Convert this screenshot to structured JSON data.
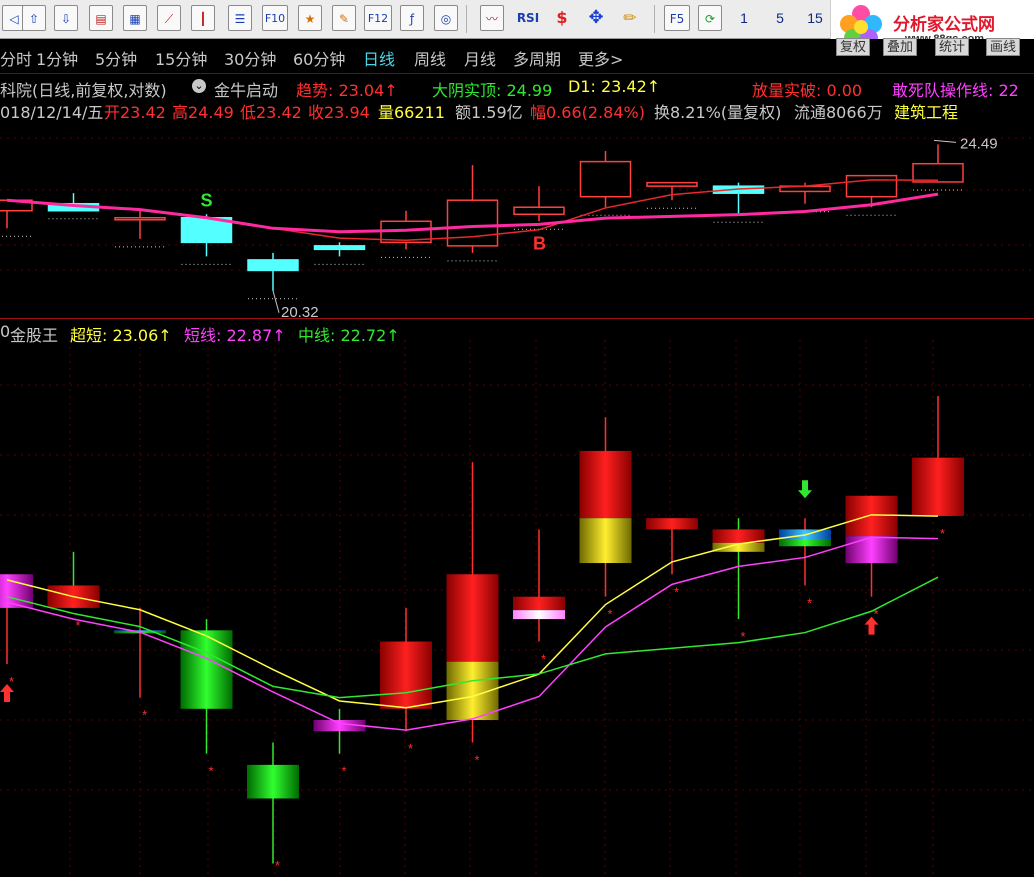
{
  "toolbar": {
    "icons": [
      "back-arrow-icon",
      "up-arrow-icon",
      "down-arrow-icon",
      "report-icon",
      "spreadsheet-icon",
      "line-chart-icon",
      "candle-chart-icon",
      "list-icon",
      "f10-icon",
      "favorite-icon",
      "note-icon",
      "f12-icon",
      "formula-icon",
      "target-icon",
      "wave-chart-icon",
      "rsi-icon",
      "money-icon",
      "move-icon",
      "pencil-icon",
      "f5-icon",
      "refresh-icon"
    ],
    "f10_label": "F10",
    "f12_label": "F12",
    "rsi_label": "RSI",
    "f5_label": "F5",
    "num1": "1",
    "num5": "5",
    "num15": "15"
  },
  "logo": {
    "title": "分析家公式网",
    "url": "www.88gs.com"
  },
  "periods": [
    "分时",
    "1分钟",
    "5分钟",
    "15分钟",
    "30分钟",
    "60分钟",
    "日线",
    "周线",
    "月线",
    "多周期",
    "更多>"
  ],
  "active_period": "日线",
  "right_buttons": [
    "复权",
    "叠加",
    "统计",
    "画线"
  ],
  "price_panel": {
    "name": "科院(日线,前复权,对数)",
    "indicator": "金牛启动",
    "trend_label": "趋势: 23.04↑",
    "dayin_label": "大阴实顶: 24.99",
    "d1_label": "D1: 23.42↑",
    "vol_break_label": "放量实破: 0.00",
    "dare_label": "敢死队操作线: 22",
    "date": "018/12/14/五",
    "open": "开23.42",
    "high": "高24.49",
    "low": "低23.42",
    "close": "收23.94",
    "volume": "量66211",
    "amount": "额1.59亿",
    "change": "幅0.66(2.84%)",
    "turnover": "换8.21%(量复权)",
    "float": "流通8066万",
    "sector": "建筑工程",
    "high_mark": "24.49",
    "low_mark": "20.32",
    "sell_signal": "S",
    "buy_signal": "B"
  },
  "indicator_panel": {
    "prefix": "0",
    "name": "金股王",
    "super_short": "超短: 23.06↑",
    "short": "短线: 22.87↑",
    "mid": "中线: 22.72↑"
  },
  "colors": {
    "up": "#ff4040",
    "down": "#54ffff",
    "ma_red": "#e8282c",
    "ma_pink": "#ff2aa0",
    "ind_yellow": "#ffff40",
    "ind_magenta": "#ff40ff",
    "ind_green": "#30e830"
  },
  "candles": [
    {
      "o": 22.6,
      "h": 22.9,
      "l": 22.1,
      "c": 22.9
    },
    {
      "o": 22.8,
      "h": 23.1,
      "l": 22.6,
      "c": 22.6
    },
    {
      "o": 22.4,
      "h": 22.6,
      "l": 21.8,
      "c": 22.4
    },
    {
      "o": 22.4,
      "h": 22.5,
      "l": 21.3,
      "c": 21.7
    },
    {
      "o": 21.2,
      "h": 21.4,
      "l": 20.32,
      "c": 20.9
    },
    {
      "o": 21.6,
      "h": 21.7,
      "l": 21.3,
      "c": 21.5
    },
    {
      "o": 21.7,
      "h": 22.6,
      "l": 21.5,
      "c": 22.3
    },
    {
      "o": 21.6,
      "h": 23.9,
      "l": 21.4,
      "c": 22.9
    },
    {
      "o": 22.5,
      "h": 23.3,
      "l": 22.3,
      "c": 22.7
    },
    {
      "o": 23.0,
      "h": 24.3,
      "l": 22.7,
      "c": 24.0
    },
    {
      "o": 23.3,
      "h": 23.4,
      "l": 22.9,
      "c": 23.4
    },
    {
      "o": 23.3,
      "h": 23.4,
      "l": 22.5,
      "c": 23.1
    },
    {
      "o": 23.15,
      "h": 23.4,
      "l": 22.8,
      "c": 23.3
    },
    {
      "o": 23.0,
      "h": 23.6,
      "l": 22.7,
      "c": 23.6
    },
    {
      "o": 23.42,
      "h": 24.49,
      "l": 23.42,
      "c": 23.94
    }
  ]
}
